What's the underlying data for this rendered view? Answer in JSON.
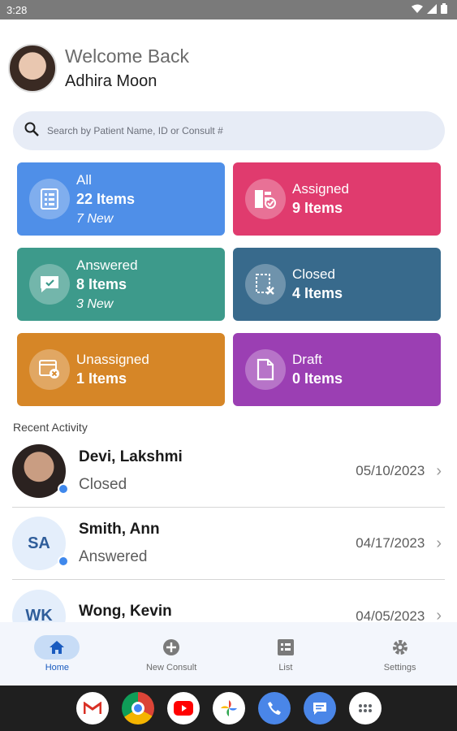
{
  "status_bar": {
    "time": "3:28",
    "icons": [
      "wifi-icon",
      "signal-icon",
      "battery-icon"
    ]
  },
  "welcome": {
    "greeting": "Welcome Back",
    "name": "Adhira Moon"
  },
  "search": {
    "placeholder": "Search by Patient Name, ID or Consult #"
  },
  "tiles": [
    {
      "title": "All",
      "count": "22 Items",
      "new": "7 New",
      "color": "#4f8fe8",
      "icon": "document-list-icon"
    },
    {
      "title": "Assigned",
      "count": "9 Items",
      "new": "",
      "color": "#e03b6e",
      "icon": "assigned-check-icon"
    },
    {
      "title": "Answered",
      "count": "8 Items",
      "new": "3 New",
      "color": "#3d9a8b",
      "icon": "answered-message-icon"
    },
    {
      "title": "Closed",
      "count": "4 Items",
      "new": "",
      "color": "#386a8c",
      "icon": "closed-document-icon"
    },
    {
      "title": "Unassigned",
      "count": "1 Items",
      "new": "",
      "color": "#d68627",
      "icon": "unassigned-window-icon"
    },
    {
      "title": "Draft",
      "count": "0 Items",
      "new": "",
      "color": "#9b3fb3",
      "icon": "draft-document-icon"
    }
  ],
  "recent": {
    "label": "Recent Activity",
    "items": [
      {
        "name": "Devi, Lakshmi",
        "status": "Closed",
        "date": "05/10/2023",
        "initials": ""
      },
      {
        "name": "Smith, Ann",
        "status": "Answered",
        "date": "04/17/2023",
        "initials": "SA"
      },
      {
        "name": "Wong, Kevin",
        "status": "",
        "date": "04/05/2023",
        "initials": "WK"
      }
    ]
  },
  "bottom_nav": [
    {
      "label": "Home",
      "icon": "home-icon",
      "active": true
    },
    {
      "label": "New Consult",
      "icon": "add-circle-icon",
      "active": false
    },
    {
      "label": "List",
      "icon": "list-icon",
      "active": false
    },
    {
      "label": "Settings",
      "icon": "gear-icon",
      "active": false
    }
  ],
  "dock": [
    "gmail-icon",
    "chrome-icon",
    "youtube-icon",
    "photos-icon",
    "phone-icon",
    "messages-icon",
    "apps-icon"
  ],
  "colors": {
    "accent": "#1a5bbf",
    "dot": "#3f88ec",
    "search_bg": "#e7ecf6"
  }
}
